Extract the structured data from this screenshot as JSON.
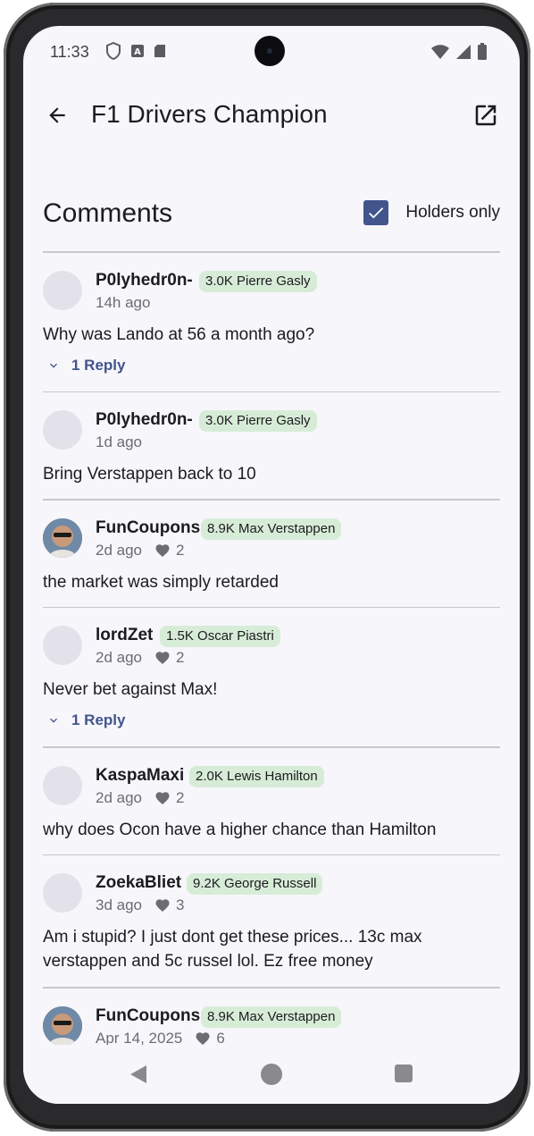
{
  "status": {
    "time": "11:33"
  },
  "appbar": {
    "title": "F1 Drivers Champion"
  },
  "header": {
    "title": "Comments",
    "holders_label": "Holders only",
    "holders_checked": true
  },
  "colors": {
    "accent": "#41558c",
    "badge_bg": "#d7ecd7",
    "background": "#f7f6fb"
  },
  "comments": [
    {
      "user": "P0lyhedr0n-",
      "badge": "3.0K Pierre Gasly",
      "time": "14h ago",
      "likes": "",
      "text": "Why was Lando at 56 a month ago?",
      "reply": "1 Reply"
    },
    {
      "user": "P0lyhedr0n-",
      "badge": "3.0K Pierre Gasly",
      "time": "1d ago",
      "likes": "",
      "text": "Bring Verstappen back to 10",
      "reply": ""
    },
    {
      "user": "FunCoupons",
      "badge": "8.9K Max Verstappen",
      "time": "2d ago",
      "likes": "2",
      "text": "the market was simply retarded",
      "reply": ""
    },
    {
      "user": "lordZet",
      "badge": "1.5K Oscar Piastri",
      "time": "2d ago",
      "likes": "2",
      "text": "Never bet against Max!",
      "reply": "1 Reply"
    },
    {
      "user": "KaspaMaxi",
      "badge": "2.0K Lewis Hamilton",
      "time": "2d ago",
      "likes": "2",
      "text": "why does Ocon have a higher chance than Hamilton",
      "reply": ""
    },
    {
      "user": "ZoekaBliet",
      "badge": "9.2K George Russell",
      "time": "3d ago",
      "likes": "3",
      "text": "Am i stupid? I just dont get these prices... 13c max verstappen and 5c russel lol. Ez free money",
      "reply": ""
    },
    {
      "user": "FunCoupons",
      "badge": "8.9K Max Verstappen",
      "time": "Apr 14, 2025",
      "likes": "6",
      "text": "",
      "reply": ""
    }
  ]
}
